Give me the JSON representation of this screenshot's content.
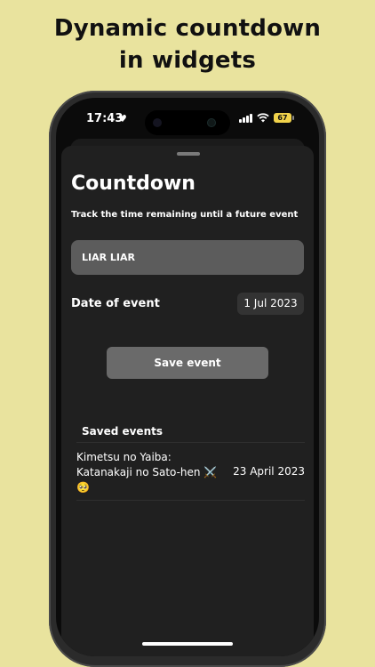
{
  "headline": {
    "line1": "Dynamic countdown",
    "line2": "in widgets"
  },
  "status_bar": {
    "time": "17:43",
    "heart_icon": "heart-icon",
    "battery": "67"
  },
  "screen": {
    "title": "Countdown",
    "subtitle": "Track the time remaining until a future event",
    "event_name_value": "LIAR LIAR",
    "date_label": "Date of event",
    "date_value": "1 Jul 2023",
    "save_label": "Save event",
    "saved_header": "Saved events",
    "saved_events": [
      {
        "name": "Kimetsu no Yaiba: Katanakaji no Sato-hen ⚔️ 🥺",
        "date": "23 April 2023"
      }
    ]
  },
  "colors": {
    "background": "#E9E39E",
    "sheet": "#202020",
    "input": "#5C5C5C",
    "button": "#6A6A6A",
    "battery": "#F1D34B"
  }
}
